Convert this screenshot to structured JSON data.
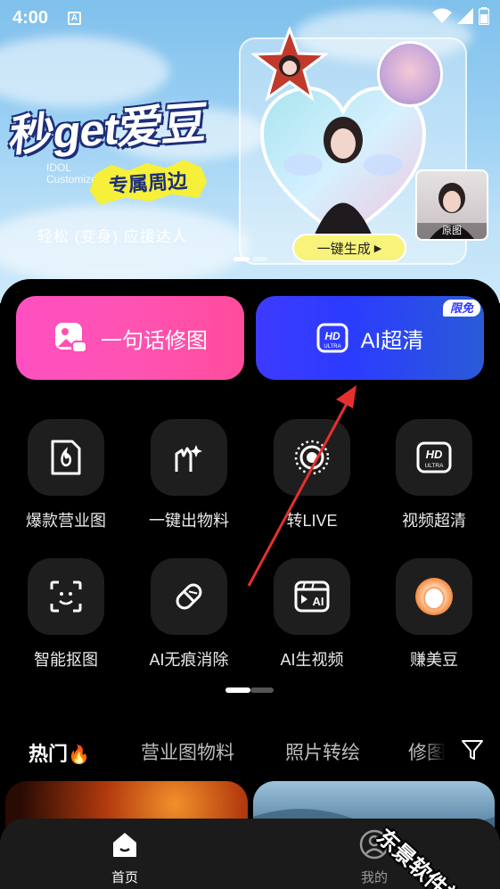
{
  "status_bar": {
    "time": "4:00",
    "notification_icon_text": "A"
  },
  "banner": {
    "headline": "秒get爱豆",
    "idol_text": "IDOL\nCustomized",
    "badge_text": "专属周边",
    "subline": "轻松 (变身) 应援达人",
    "original_label": "原图",
    "generate_button": "一键生成",
    "generate_arrow": "▶"
  },
  "actions": {
    "edit": {
      "label": "一句话修图"
    },
    "hd": {
      "label": "AI超清",
      "badge": "限免",
      "icon_text": "HD",
      "icon_sub": "ULTRA"
    }
  },
  "tools": [
    {
      "label": "爆款营业图",
      "icon": "poster-icon"
    },
    {
      "label": "一键出物料",
      "icon": "sparkle-hand-icon"
    },
    {
      "label": "转LIVE",
      "icon": "live-icon"
    },
    {
      "label": "视频超清",
      "icon": "hd-icon",
      "icon_text": "HD",
      "icon_sub": "ULTRA"
    },
    {
      "label": "智能抠图",
      "icon": "face-scan-icon"
    },
    {
      "label": "AI无痕消除",
      "icon": "eraser-icon"
    },
    {
      "label": "AI生视频",
      "icon": "ai-video-icon",
      "icon_text": "AI"
    },
    {
      "label": "赚美豆",
      "icon": "bean-icon"
    }
  ],
  "tabs": [
    {
      "label": "热门",
      "emoji": "🔥"
    },
    {
      "label": "营业图物料"
    },
    {
      "label": "照片转绘"
    },
    {
      "label": "修图"
    }
  ],
  "nav": [
    {
      "label": "首页",
      "icon": "home-icon"
    },
    {
      "label": "我的",
      "icon": "profile-icon"
    }
  ],
  "watermark": "东景软件站",
  "colors": {
    "edit_gradient_start": "#ff4fc1",
    "hd_gradient_start": "#3d3bff",
    "badge_text": "#2f37ff",
    "annotation_arrow": "#e53030"
  }
}
